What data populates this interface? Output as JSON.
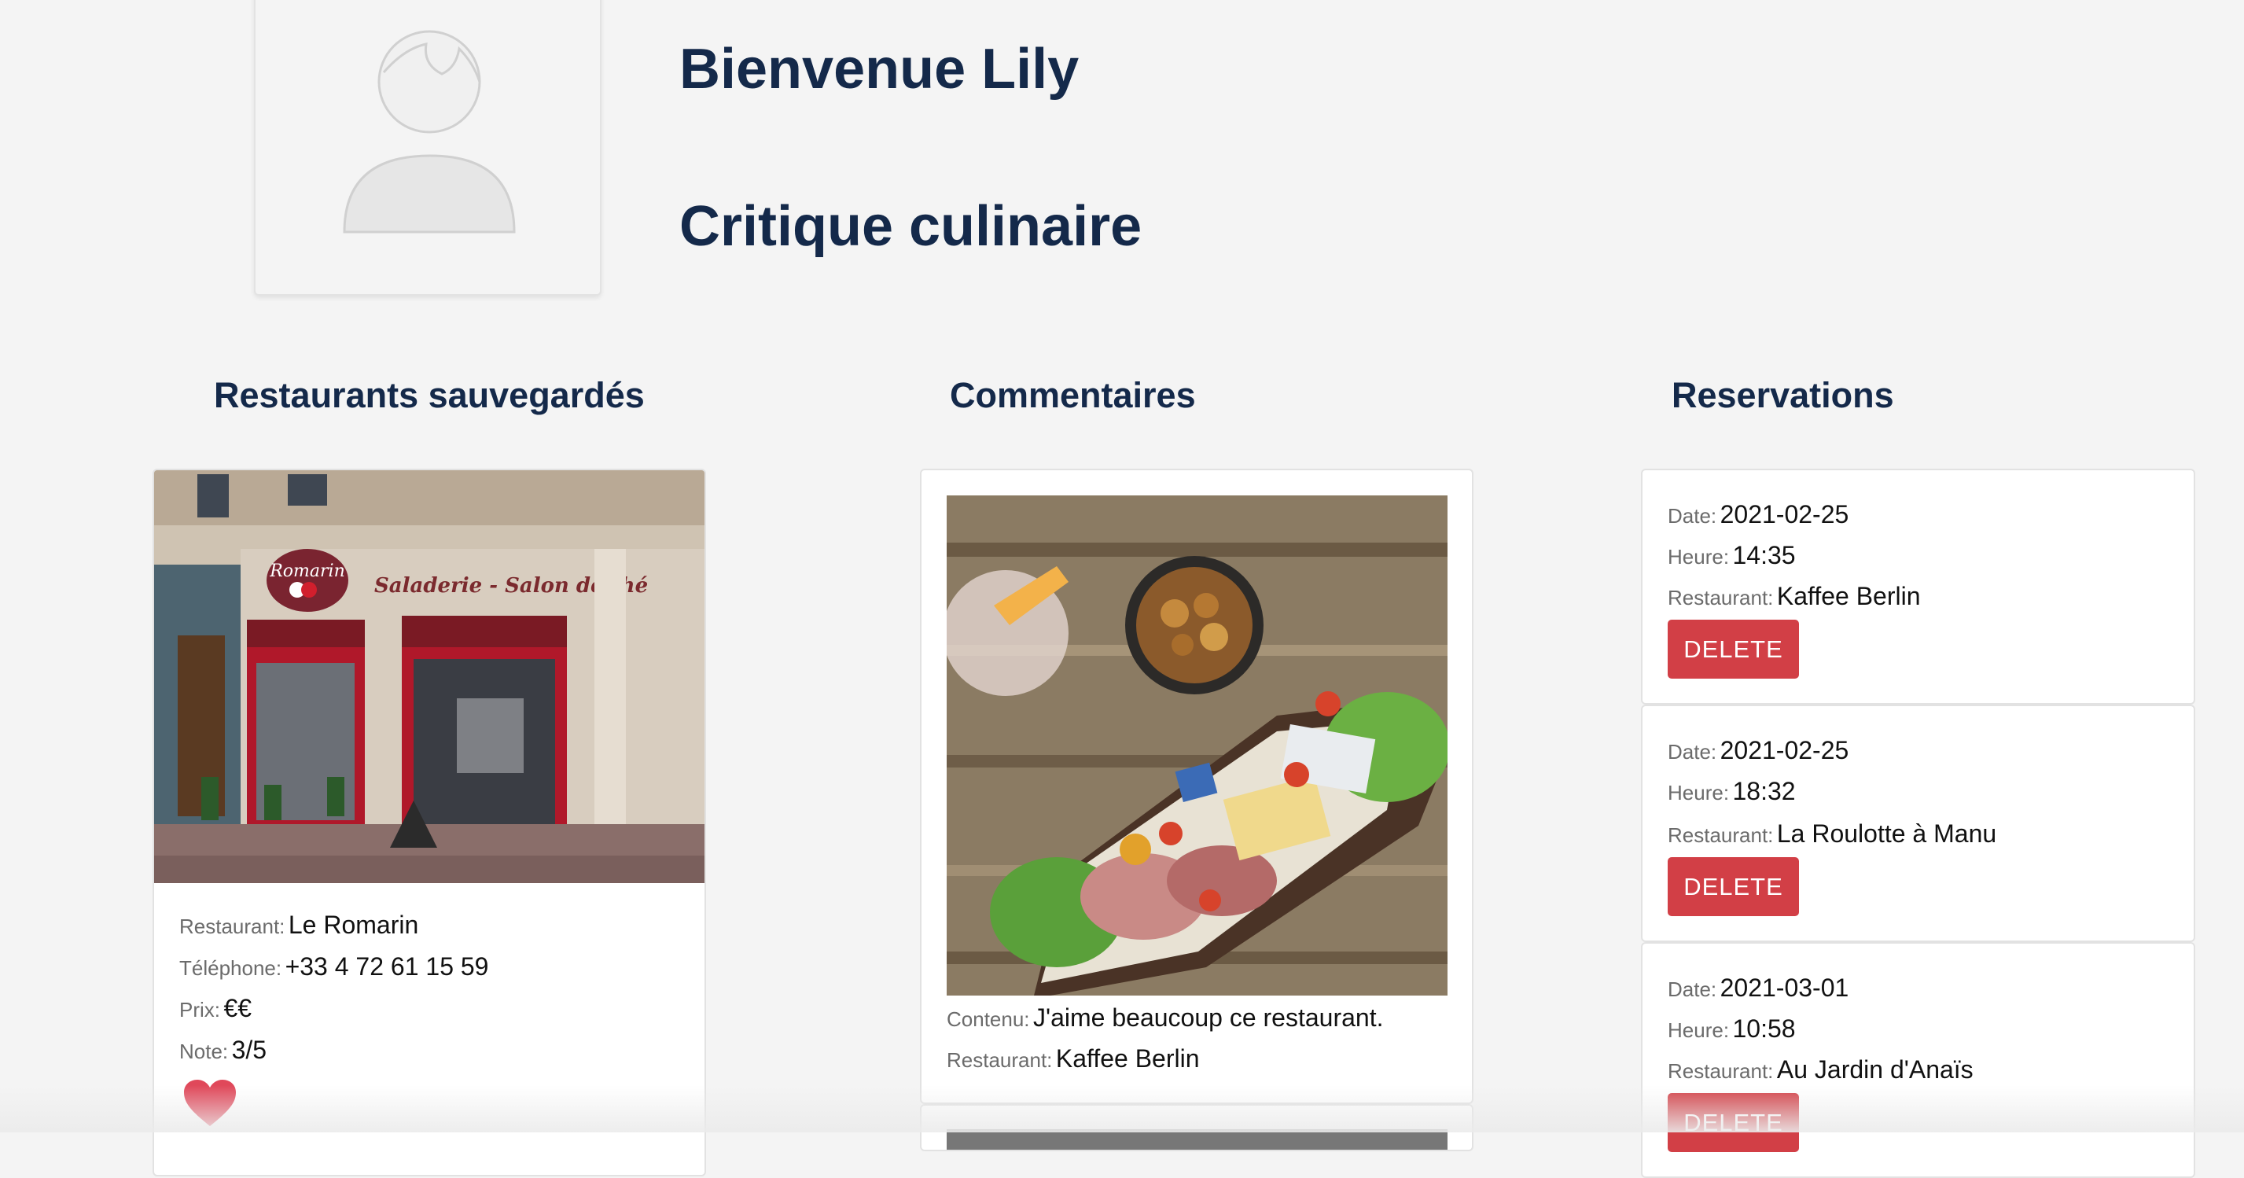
{
  "profile": {
    "greeting": "Bienvenue Lily",
    "role": "Critique culinaire"
  },
  "columns": {
    "saved_title": "Restaurants sauvegardés",
    "comments_title": "Commentaires",
    "reservations_title": "Reservations"
  },
  "saved_restaurant": {
    "restaurant_label": "Restaurant:",
    "restaurant": "Le Romarin",
    "phone_label": "Téléphone:",
    "phone": "+33 4 72 61 15 59",
    "price_label": "Prix:",
    "price": "€€",
    "rating_label": "Note:",
    "rating": "3/5",
    "storefront_sign": "Romarin",
    "storefront_banner": "Saladerie - Salon de thé"
  },
  "comment": {
    "content_label": "Contenu:",
    "content": "J'aime beaucoup ce restaurant.",
    "restaurant_label": "Restaurant:",
    "restaurant": "Kaffee Berlin"
  },
  "reservations": [
    {
      "date_label": "Date:",
      "date": "2021-02-25",
      "time_label": "Heure:",
      "time": "14:35",
      "restaurant_label": "Restaurant:",
      "restaurant": "Kaffee Berlin",
      "delete_label": "DELETE"
    },
    {
      "date_label": "Date:",
      "date": "2021-02-25",
      "time_label": "Heure:",
      "time": "18:32",
      "restaurant_label": "Restaurant:",
      "restaurant": "La Roulotte à Manu",
      "delete_label": "DELETE"
    },
    {
      "date_label": "Date:",
      "date": "2021-03-01",
      "time_label": "Heure:",
      "time": "10:58",
      "restaurant_label": "Restaurant:",
      "restaurant": "Au Jardin d'Anaïs",
      "delete_label": "DELETE"
    }
  ],
  "colors": {
    "heading": "#14294a",
    "delete": "#d23f46",
    "heart": "#e0485a",
    "background": "#f4f4f4"
  },
  "icons": [
    "user-placeholder-icon",
    "heart-icon"
  ]
}
